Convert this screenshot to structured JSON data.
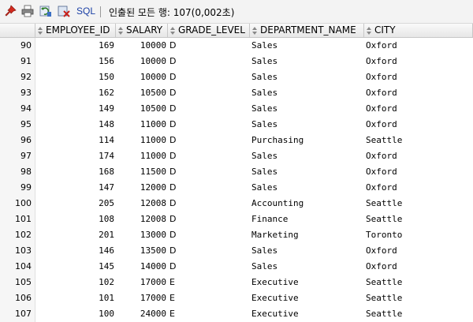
{
  "toolbar": {
    "sql_label": "SQL",
    "status_text": "인출된 모든 행: 107(0,002초)",
    "icons": [
      "pin-icon",
      "print-icon",
      "refresh-icon",
      "export-icon"
    ]
  },
  "grid": {
    "columns": [
      "EMPLOYEE_ID",
      "SALARY",
      "GRADE_LEVEL",
      "DEPARTMENT_NAME",
      "CITY"
    ],
    "rows": [
      {
        "n": "90",
        "emp": "169",
        "sal": "10000",
        "grade": "D",
        "dept": "Sales",
        "city": "Oxford"
      },
      {
        "n": "91",
        "emp": "156",
        "sal": "10000",
        "grade": "D",
        "dept": "Sales",
        "city": "Oxford"
      },
      {
        "n": "92",
        "emp": "150",
        "sal": "10000",
        "grade": "D",
        "dept": "Sales",
        "city": "Oxford"
      },
      {
        "n": "93",
        "emp": "162",
        "sal": "10500",
        "grade": "D",
        "dept": "Sales",
        "city": "Oxford"
      },
      {
        "n": "94",
        "emp": "149",
        "sal": "10500",
        "grade": "D",
        "dept": "Sales",
        "city": "Oxford"
      },
      {
        "n": "95",
        "emp": "148",
        "sal": "11000",
        "grade": "D",
        "dept": "Sales",
        "city": "Oxford"
      },
      {
        "n": "96",
        "emp": "114",
        "sal": "11000",
        "grade": "D",
        "dept": "Purchasing",
        "city": "Seattle"
      },
      {
        "n": "97",
        "emp": "174",
        "sal": "11000",
        "grade": "D",
        "dept": "Sales",
        "city": "Oxford"
      },
      {
        "n": "98",
        "emp": "168",
        "sal": "11500",
        "grade": "D",
        "dept": "Sales",
        "city": "Oxford"
      },
      {
        "n": "99",
        "emp": "147",
        "sal": "12000",
        "grade": "D",
        "dept": "Sales",
        "city": "Oxford"
      },
      {
        "n": "100",
        "emp": "205",
        "sal": "12008",
        "grade": "D",
        "dept": "Accounting",
        "city": "Seattle"
      },
      {
        "n": "101",
        "emp": "108",
        "sal": "12008",
        "grade": "D",
        "dept": "Finance",
        "city": "Seattle"
      },
      {
        "n": "102",
        "emp": "201",
        "sal": "13000",
        "grade": "D",
        "dept": "Marketing",
        "city": "Toronto"
      },
      {
        "n": "103",
        "emp": "146",
        "sal": "13500",
        "grade": "D",
        "dept": "Sales",
        "city": "Oxford"
      },
      {
        "n": "104",
        "emp": "145",
        "sal": "14000",
        "grade": "D",
        "dept": "Sales",
        "city": "Oxford"
      },
      {
        "n": "105",
        "emp": "102",
        "sal": "17000",
        "grade": "E",
        "dept": "Executive",
        "city": "Seattle"
      },
      {
        "n": "106",
        "emp": "101",
        "sal": "17000",
        "grade": "E",
        "dept": "Executive",
        "city": "Seattle"
      },
      {
        "n": "107",
        "emp": "100",
        "sal": "24000",
        "grade": "E",
        "dept": "Executive",
        "city": "Seattle"
      }
    ]
  }
}
